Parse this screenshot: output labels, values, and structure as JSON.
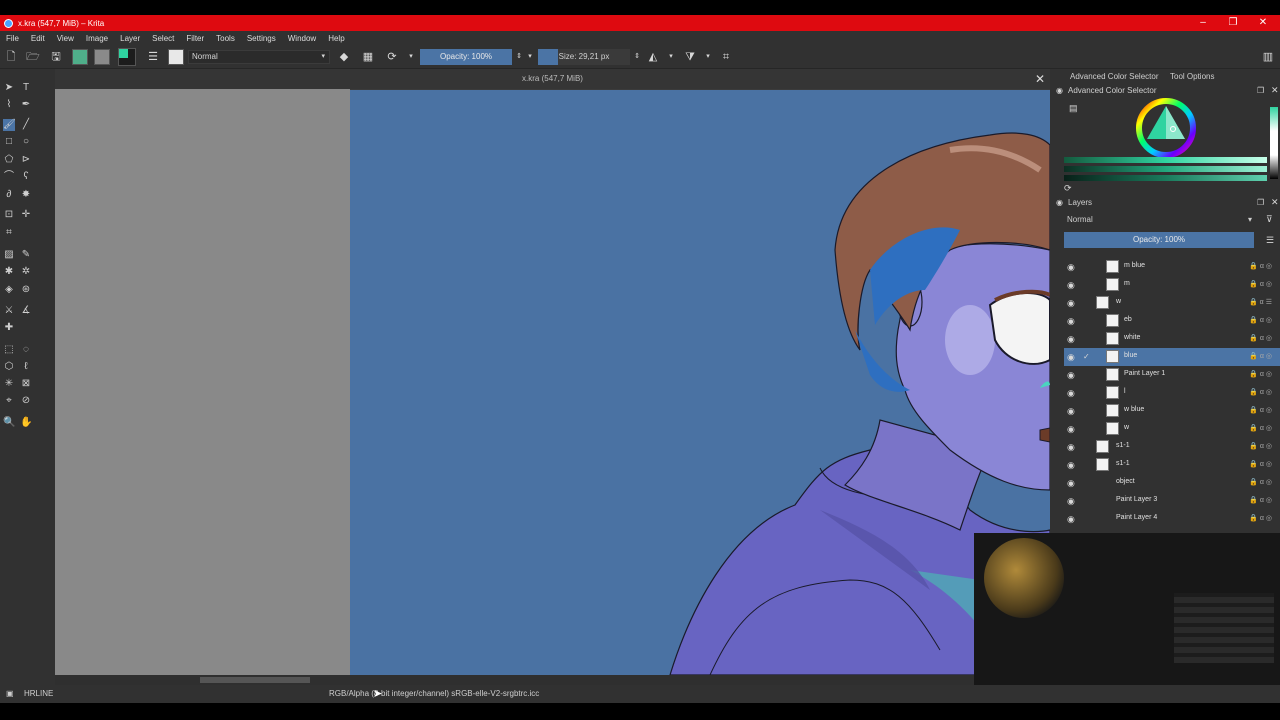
{
  "colors": {
    "titlebar": "#de0a10",
    "accent": "#4b74a5",
    "panel": "#313131",
    "canvas_bg": "#4a72a3",
    "foreground_color": "#2fd3a0",
    "background_color": "#1c1c1c"
  },
  "window": {
    "title": "x.kra (547,7 MiB) – Krita",
    "minimize": "–",
    "maximize": "❐",
    "close": "✕"
  },
  "menu": [
    "File",
    "Edit",
    "View",
    "Image",
    "Layer",
    "Select",
    "Filter",
    "Tools",
    "Settings",
    "Window",
    "Help"
  ],
  "toolbar": {
    "blend_mode": "Normal",
    "opacity": "Opacity: 100%",
    "size": "Size: 29,21 px"
  },
  "document": {
    "tab_title": "x.kra (547,7 MiB)",
    "close": "✕"
  },
  "right_panel": {
    "tabs": [
      "Advanced Color Selector",
      "Tool Options"
    ],
    "color_selector_title": "Advanced Color Selector",
    "layers_title": "Layers",
    "blend_mode": "Normal",
    "opacity": "Opacity: 100%",
    "layers": [
      {
        "name": "m blue",
        "selected": false
      },
      {
        "name": "m",
        "selected": false
      },
      {
        "name": "w",
        "selected": false
      },
      {
        "name": "eb",
        "selected": false
      },
      {
        "name": "white",
        "selected": false
      },
      {
        "name": "blue",
        "selected": true
      },
      {
        "name": "Paint Layer 1",
        "selected": false
      },
      {
        "name": "l",
        "selected": false
      },
      {
        "name": "w blue",
        "selected": false
      },
      {
        "name": "w",
        "selected": false
      },
      {
        "name": "s1-1",
        "selected": false
      },
      {
        "name": "s1-1",
        "selected": false
      },
      {
        "name": "object",
        "selected": false
      },
      {
        "name": "Paint Layer 3",
        "selected": false
      },
      {
        "name": "Paint Layer 4",
        "selected": false
      }
    ]
  },
  "status": {
    "brush_preset": "HRLINE",
    "color_info": "RGB/Alpha (8-bit integer/channel)  sRGB-elle-V2-srgbtrc.icc"
  }
}
